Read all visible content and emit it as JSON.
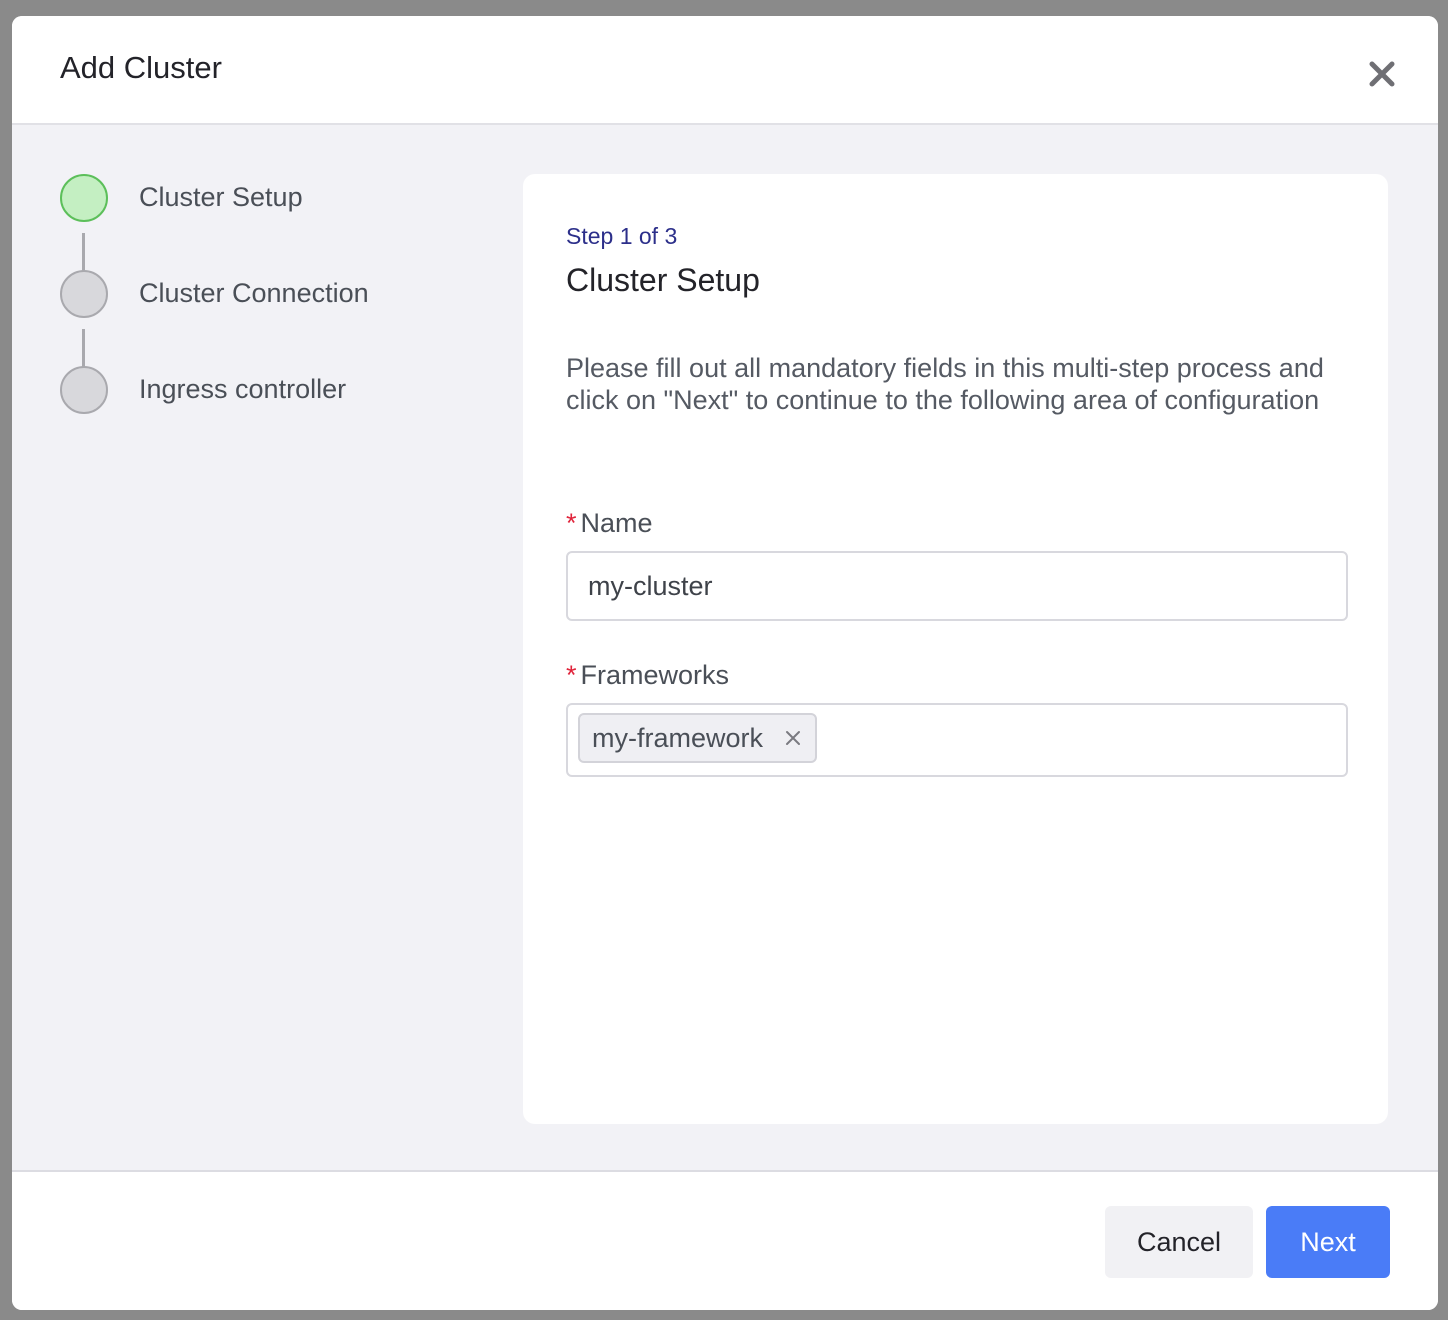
{
  "modal": {
    "title": "Add Cluster",
    "close_icon": "close-icon"
  },
  "stepper": {
    "steps": [
      {
        "label": "Cluster Setup",
        "state": "active"
      },
      {
        "label": "Cluster Connection",
        "state": "pending"
      },
      {
        "label": "Ingress controller",
        "state": "pending"
      }
    ]
  },
  "card": {
    "step_count": "Step 1 of 3",
    "title": "Cluster Setup",
    "description": "Please fill out all mandatory fields in this multi-step process and click on \"Next\" to continue to the following area of configuration"
  },
  "form": {
    "required_marker": "*",
    "name": {
      "label": "Name",
      "value": "my-cluster"
    },
    "frameworks": {
      "label": "Frameworks",
      "tags": [
        "my-framework"
      ]
    }
  },
  "footer": {
    "cancel_label": "Cancel",
    "next_label": "Next"
  },
  "colors": {
    "accent": "#4a7cf7",
    "active_step": "#c4efc2",
    "required": "#e0243b"
  }
}
